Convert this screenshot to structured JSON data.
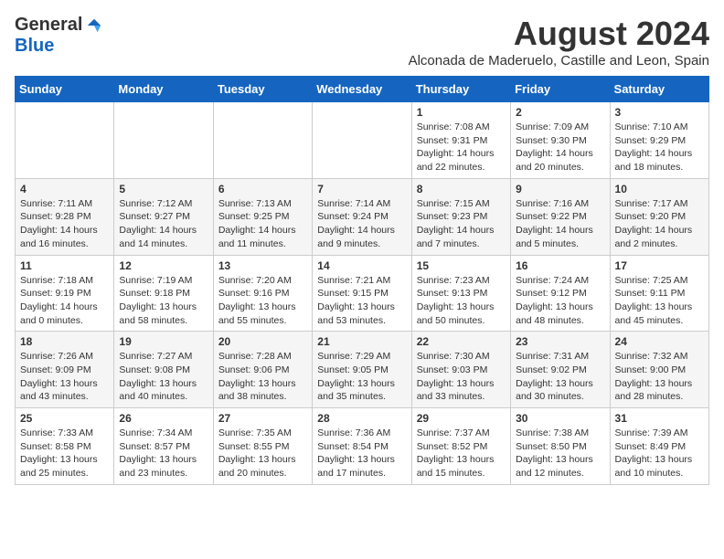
{
  "header": {
    "logo_general": "General",
    "logo_blue": "Blue",
    "month_year": "August 2024",
    "location": "Alconada de Maderuelo, Castille and Leon, Spain"
  },
  "days_of_week": [
    "Sunday",
    "Monday",
    "Tuesday",
    "Wednesday",
    "Thursday",
    "Friday",
    "Saturday"
  ],
  "weeks": [
    [
      {
        "day": "",
        "info": ""
      },
      {
        "day": "",
        "info": ""
      },
      {
        "day": "",
        "info": ""
      },
      {
        "day": "",
        "info": ""
      },
      {
        "day": "1",
        "info": "Sunrise: 7:08 AM\nSunset: 9:31 PM\nDaylight: 14 hours and 22 minutes."
      },
      {
        "day": "2",
        "info": "Sunrise: 7:09 AM\nSunset: 9:30 PM\nDaylight: 14 hours and 20 minutes."
      },
      {
        "day": "3",
        "info": "Sunrise: 7:10 AM\nSunset: 9:29 PM\nDaylight: 14 hours and 18 minutes."
      }
    ],
    [
      {
        "day": "4",
        "info": "Sunrise: 7:11 AM\nSunset: 9:28 PM\nDaylight: 14 hours and 16 minutes."
      },
      {
        "day": "5",
        "info": "Sunrise: 7:12 AM\nSunset: 9:27 PM\nDaylight: 14 hours and 14 minutes."
      },
      {
        "day": "6",
        "info": "Sunrise: 7:13 AM\nSunset: 9:25 PM\nDaylight: 14 hours and 11 minutes."
      },
      {
        "day": "7",
        "info": "Sunrise: 7:14 AM\nSunset: 9:24 PM\nDaylight: 14 hours and 9 minutes."
      },
      {
        "day": "8",
        "info": "Sunrise: 7:15 AM\nSunset: 9:23 PM\nDaylight: 14 hours and 7 minutes."
      },
      {
        "day": "9",
        "info": "Sunrise: 7:16 AM\nSunset: 9:22 PM\nDaylight: 14 hours and 5 minutes."
      },
      {
        "day": "10",
        "info": "Sunrise: 7:17 AM\nSunset: 9:20 PM\nDaylight: 14 hours and 2 minutes."
      }
    ],
    [
      {
        "day": "11",
        "info": "Sunrise: 7:18 AM\nSunset: 9:19 PM\nDaylight: 14 hours and 0 minutes."
      },
      {
        "day": "12",
        "info": "Sunrise: 7:19 AM\nSunset: 9:18 PM\nDaylight: 13 hours and 58 minutes."
      },
      {
        "day": "13",
        "info": "Sunrise: 7:20 AM\nSunset: 9:16 PM\nDaylight: 13 hours and 55 minutes."
      },
      {
        "day": "14",
        "info": "Sunrise: 7:21 AM\nSunset: 9:15 PM\nDaylight: 13 hours and 53 minutes."
      },
      {
        "day": "15",
        "info": "Sunrise: 7:23 AM\nSunset: 9:13 PM\nDaylight: 13 hours and 50 minutes."
      },
      {
        "day": "16",
        "info": "Sunrise: 7:24 AM\nSunset: 9:12 PM\nDaylight: 13 hours and 48 minutes."
      },
      {
        "day": "17",
        "info": "Sunrise: 7:25 AM\nSunset: 9:11 PM\nDaylight: 13 hours and 45 minutes."
      }
    ],
    [
      {
        "day": "18",
        "info": "Sunrise: 7:26 AM\nSunset: 9:09 PM\nDaylight: 13 hours and 43 minutes."
      },
      {
        "day": "19",
        "info": "Sunrise: 7:27 AM\nSunset: 9:08 PM\nDaylight: 13 hours and 40 minutes."
      },
      {
        "day": "20",
        "info": "Sunrise: 7:28 AM\nSunset: 9:06 PM\nDaylight: 13 hours and 38 minutes."
      },
      {
        "day": "21",
        "info": "Sunrise: 7:29 AM\nSunset: 9:05 PM\nDaylight: 13 hours and 35 minutes."
      },
      {
        "day": "22",
        "info": "Sunrise: 7:30 AM\nSunset: 9:03 PM\nDaylight: 13 hours and 33 minutes."
      },
      {
        "day": "23",
        "info": "Sunrise: 7:31 AM\nSunset: 9:02 PM\nDaylight: 13 hours and 30 minutes."
      },
      {
        "day": "24",
        "info": "Sunrise: 7:32 AM\nSunset: 9:00 PM\nDaylight: 13 hours and 28 minutes."
      }
    ],
    [
      {
        "day": "25",
        "info": "Sunrise: 7:33 AM\nSunset: 8:58 PM\nDaylight: 13 hours and 25 minutes."
      },
      {
        "day": "26",
        "info": "Sunrise: 7:34 AM\nSunset: 8:57 PM\nDaylight: 13 hours and 23 minutes."
      },
      {
        "day": "27",
        "info": "Sunrise: 7:35 AM\nSunset: 8:55 PM\nDaylight: 13 hours and 20 minutes."
      },
      {
        "day": "28",
        "info": "Sunrise: 7:36 AM\nSunset: 8:54 PM\nDaylight: 13 hours and 17 minutes."
      },
      {
        "day": "29",
        "info": "Sunrise: 7:37 AM\nSunset: 8:52 PM\nDaylight: 13 hours and 15 minutes."
      },
      {
        "day": "30",
        "info": "Sunrise: 7:38 AM\nSunset: 8:50 PM\nDaylight: 13 hours and 12 minutes."
      },
      {
        "day": "31",
        "info": "Sunrise: 7:39 AM\nSunset: 8:49 PM\nDaylight: 13 hours and 10 minutes."
      }
    ]
  ]
}
